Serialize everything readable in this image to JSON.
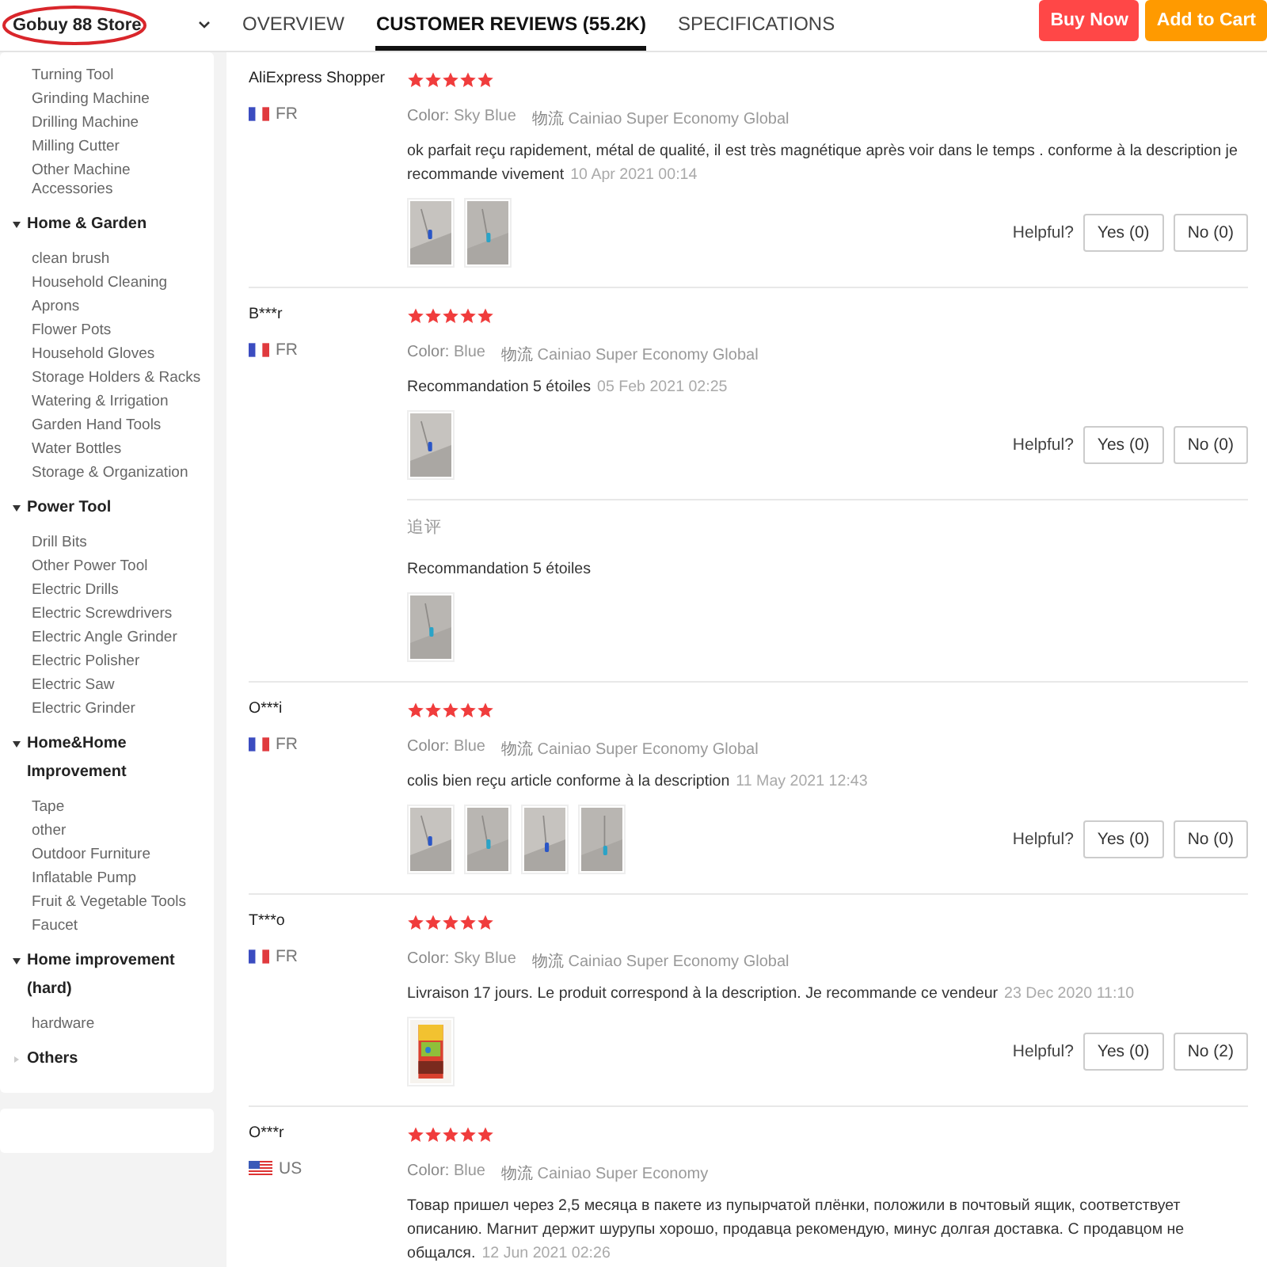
{
  "store": {
    "name": "Gobuy 88 Store",
    "highlighted": true
  },
  "tabs": [
    {
      "label": "OVERVIEW",
      "selected": false
    },
    {
      "label": "CUSTOMER REVIEWS (55.2K)",
      "selected": true
    },
    {
      "label": "SPECIFICATIONS",
      "selected": false
    }
  ],
  "actions": [
    {
      "label": "Buy Now",
      "kind": "buy"
    },
    {
      "label": "Add to Cart",
      "kind": "cart"
    }
  ],
  "sidebar": {
    "groups": [
      {
        "items": [
          "Turning Tool",
          "Grinding Machine",
          "Drilling Machine",
          "Milling Cutter",
          "Other Machine Accessories"
        ]
      },
      {
        "title": "Home & Garden",
        "expanded": true,
        "items": [
          "clean brush",
          "Household Cleaning",
          "Aprons",
          "Flower Pots",
          "Household Gloves",
          "Storage Holders & Racks",
          "Watering & Irrigation",
          "Garden Hand Tools",
          "Water Bottles",
          "Storage & Organization"
        ]
      },
      {
        "title": "Power Tool",
        "expanded": true,
        "items": [
          "Drill Bits",
          "Other Power Tool",
          "Electric Drills",
          "Electric Screwdrivers",
          "Electric Angle Grinder",
          "Electric Polisher",
          "Electric Saw",
          "Electric Grinder"
        ]
      },
      {
        "title": "Home&Home Improvement",
        "expanded": true,
        "items": [
          "Tape",
          "other",
          "Outdoor Furniture",
          "Inflatable Pump",
          "Fruit & Vegetable Tools",
          "Faucet"
        ]
      },
      {
        "title": "Home improvement (hard)",
        "expanded": true,
        "items": [
          "hardware"
        ]
      },
      {
        "title": "Others",
        "expanded": false
      }
    ]
  },
  "reviews": [
    {
      "user": "AliExpress Shopper",
      "flag": {
        "kind": "fr"
      },
      "country": "FR",
      "stars": 5,
      "color_label": "Color:",
      "color_value": "Sky Blue",
      "shipping_label": "物流",
      "shipping": "Cainiao Super Economy Global",
      "text": "ok parfait reçu rapidement, métal de qualité, il est très magnétique après voir dans le temps . conforme à la description je recommande vivement",
      "date": "10 Apr 2021 00:14",
      "photos": [
        {
          "kind": "picture"
        },
        {
          "kind": "picture"
        }
      ],
      "helpful_label": "Helpful?",
      "yes": "Yes (0)",
      "no": "No (0)"
    },
    {
      "user": "B***r",
      "flag": {
        "kind": "fr"
      },
      "country": "FR",
      "stars": 5,
      "color_label": "Color:",
      "color_value": "Blue",
      "shipping_label": "物流",
      "shipping": "Cainiao Super Economy Global",
      "text": "Recommandation 5 étoiles",
      "date": "05 Feb 2021 02:25",
      "photos": [
        {
          "kind": "picture"
        }
      ],
      "helpful_label": "Helpful?",
      "yes": "Yes (0)",
      "no": "No (0)",
      "followup": {
        "label": "追评",
        "text": "Recommandation 5 étoiles",
        "photos": [
          {
            "kind": "picture"
          }
        ]
      }
    },
    {
      "user": "O***i",
      "flag": {
        "kind": "fr"
      },
      "country": "FR",
      "stars": 5,
      "color_label": "Color:",
      "color_value": "Blue",
      "shipping_label": "物流",
      "shipping": "Cainiao Super Economy Global",
      "text": "colis bien reçu article conforme à la description",
      "date": "11 May 2021 12:43",
      "photos": [
        {
          "kind": "picture"
        },
        {
          "kind": "picture"
        },
        {
          "kind": "picture"
        },
        {
          "kind": "picture"
        }
      ],
      "helpful_label": "Helpful?",
      "yes": "Yes (0)",
      "no": "No (0)"
    },
    {
      "user": "T***o",
      "flag": {
        "kind": "fr"
      },
      "country": "FR",
      "stars": 5,
      "color_label": "Color:",
      "color_value": "Sky Blue",
      "shipping_label": "物流",
      "shipping": "Cainiao Super Economy Global",
      "text": "Livraison 17 jours. Le produit correspond à la description. Je recommande ce vendeur",
      "date": "23 Dec 2020 11:10",
      "photos": [
        {
          "kind": "picture"
        }
      ],
      "helpful_label": "Helpful?",
      "yes": "Yes (0)",
      "no": "No (2)"
    },
    {
      "user": "O***r",
      "flag": {
        "kind": "us"
      },
      "country": "US",
      "stars": 5,
      "color_label": "Color:",
      "color_value": "Blue",
      "shipping_label": "物流",
      "shipping": "Cainiao Super Economy",
      "text": "Товар пришел через 2,5 месяца в пакете из пупырчатой плёнки, положили в почтовый ящик, соответствует описанию. Магнит держит шурупы хорошо, продавца рекомендую, минус долгая доставка. С продавцом не общался.",
      "date": "12 Jun 2021 02:26"
    }
  ]
}
